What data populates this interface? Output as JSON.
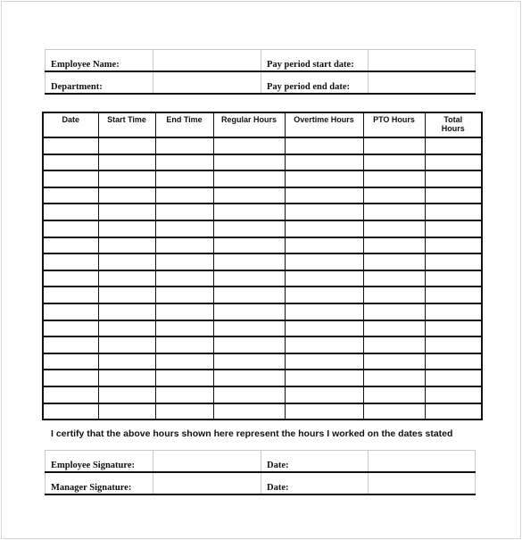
{
  "header_info": {
    "rows": [
      {
        "left_label": "Employee Name:",
        "left_value": "",
        "right_label": "Pay period start date:",
        "right_value": ""
      },
      {
        "left_label": "Department:",
        "left_value": "",
        "right_label": "Pay period end date:",
        "right_value": ""
      }
    ]
  },
  "timesheet": {
    "columns": [
      "Date",
      "Start Time",
      "End Time",
      "Regular Hours",
      "Overtime Hours",
      "PTO Hours",
      "Total Hours"
    ],
    "row_count": 17
  },
  "certification_text": "I certify that the above hours shown here represent the hours I worked on the dates stated",
  "signature_info": {
    "rows": [
      {
        "left_label": "Employee Signature:",
        "left_value": "",
        "right_label": "Date:",
        "right_value": ""
      },
      {
        "left_label": "Manager Signature:",
        "left_value": "",
        "right_label": "Date:",
        "right_value": ""
      }
    ]
  }
}
